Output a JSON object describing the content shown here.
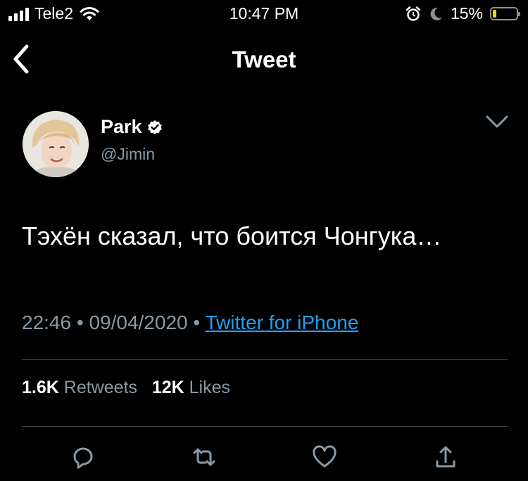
{
  "status_bar": {
    "carrier": "Tele2",
    "time": "10:47 PM",
    "battery_percent": "15%",
    "battery_level": 0.15,
    "icons": [
      "signal-icon",
      "wifi-icon",
      "alarm-icon",
      "moon-icon",
      "battery-icon"
    ]
  },
  "nav": {
    "title": "Tweet",
    "back_icon": "chevron-left-icon"
  },
  "tweet": {
    "author_name": "Park",
    "verified": true,
    "handle": "@Jimin",
    "text": "Тэхён сказал, что боится Чонгука…",
    "time": "22:46",
    "separator": "•",
    "date": "09/04/2020",
    "source": "Twitter for iPhone",
    "stats": {
      "retweets_count": "1.6K",
      "retweets_label": "Retweets",
      "likes_count": "12K",
      "likes_label": "Likes"
    }
  },
  "actions": [
    {
      "name": "reply",
      "icon": "comment-icon"
    },
    {
      "name": "retweet",
      "icon": "retweet-icon"
    },
    {
      "name": "like",
      "icon": "heart-icon"
    },
    {
      "name": "share",
      "icon": "share-icon"
    }
  ],
  "colors": {
    "background": "#000000",
    "text": "#ffffff",
    "secondary": "#8899a6",
    "link": "#1da1f2",
    "divider": "#38444d",
    "battery_low": "#ffd60a"
  }
}
